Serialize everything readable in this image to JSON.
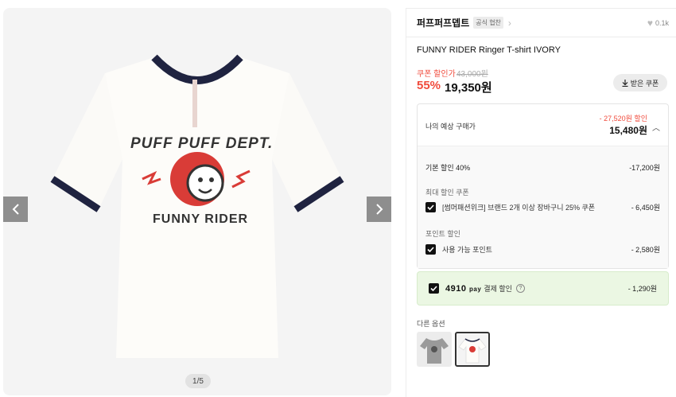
{
  "gallery": {
    "print_line1": "PUFF PUFF DEPT.",
    "print_line2": "FUNNY RIDER",
    "pager": "1/5"
  },
  "brand": {
    "name": "퍼프퍼프뎁트",
    "badge": "공식 협찬",
    "likes": "0.1k"
  },
  "product": {
    "title": "FUNNY RIDER Ringer T-shirt IVORY",
    "coupon_label": "쿠폰 할인가",
    "original_price": "43,000원",
    "discount_rate": "55%",
    "final_price": "19,350원",
    "coupon_button": "받은 쿠폰"
  },
  "calc": {
    "label": "나의 예상 구매가",
    "saved": "- 27,520원 할인",
    "total": "15,480원",
    "base_discount_label": "기본 할인 40%",
    "base_discount_amount": "-17,200원",
    "max_coupon_title": "최대 할인 쿠폰",
    "coupon_item": "[썸머패션위크] 브랜드 2개 이상 장바구니 25% 쿠폰",
    "coupon_amount": "- 6,450원",
    "point_title": "포인트 할인",
    "point_item": "사용 가능 포인트",
    "point_amount": "- 2,580원"
  },
  "pay": {
    "logo_main": "4910",
    "logo_sub": "pay",
    "label": "결제 할인",
    "amount": "- 1,290원"
  },
  "options": {
    "label": "다른 옵션"
  },
  "colors": {
    "accent_red": "#f04b3c",
    "navy_trim": "#1f2340",
    "pay_green_bg": "#ebf7e3"
  }
}
